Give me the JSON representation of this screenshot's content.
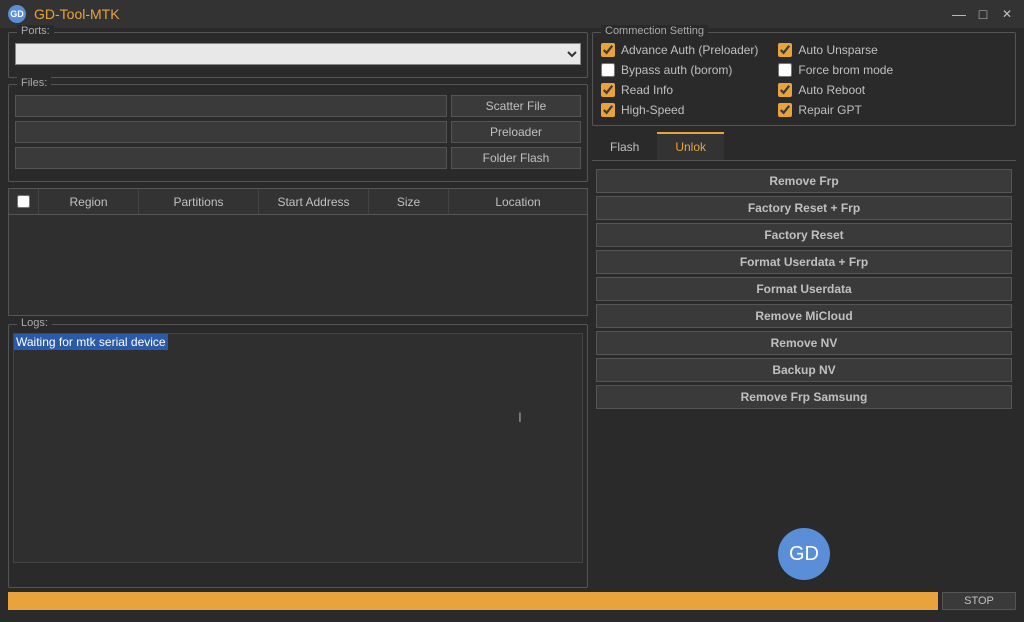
{
  "window": {
    "title": "GD-Tool-MTK",
    "logo_text": "GD"
  },
  "ports": {
    "label": "Ports:"
  },
  "files": {
    "label": "Files:",
    "buttons": {
      "scatter": "Scatter File",
      "preloader": "Preloader",
      "folder": "Folder Flash"
    }
  },
  "table": {
    "headers": {
      "region": "Region",
      "partitions": "Partitions",
      "start": "Start Address",
      "size": "Size",
      "location": "Location"
    }
  },
  "logs": {
    "label": "Logs:",
    "content": "Waiting for mtk serial device"
  },
  "connection": {
    "label": "Commection Setting",
    "left": {
      "advance_auth": "Advance Auth (Preloader)",
      "bypass_auth": "Bypass auth (borom)",
      "read_info": "Read Info",
      "high_speed": "High-Speed"
    },
    "right": {
      "auto_unsparse": "Auto Unsparse",
      "force_brom": "Force brom mode",
      "auto_reboot": "Auto Reboot",
      "repair_gpt": "Repair GPT"
    },
    "checked": {
      "advance_auth": true,
      "bypass_auth": false,
      "read_info": true,
      "high_speed": true,
      "auto_unsparse": true,
      "force_brom": false,
      "auto_reboot": true,
      "repair_gpt": true
    }
  },
  "tabs": {
    "flash": "Flash",
    "unlock": "Unlok"
  },
  "actions": {
    "remove_frp": "Remove Frp",
    "factory_reset_frp": "Factory Reset + Frp",
    "factory_reset": "Factory Reset",
    "format_userdata_frp": "Format Userdata + Frp",
    "format_userdata": "Format Userdata",
    "remove_micloud": "Remove MiCloud",
    "remove_nv": "Remove NV",
    "backup_nv": "Backup NV",
    "remove_frp_samsung": "Remove Frp Samsung"
  },
  "bottom": {
    "stop": "STOP"
  },
  "big_logo": "GD"
}
